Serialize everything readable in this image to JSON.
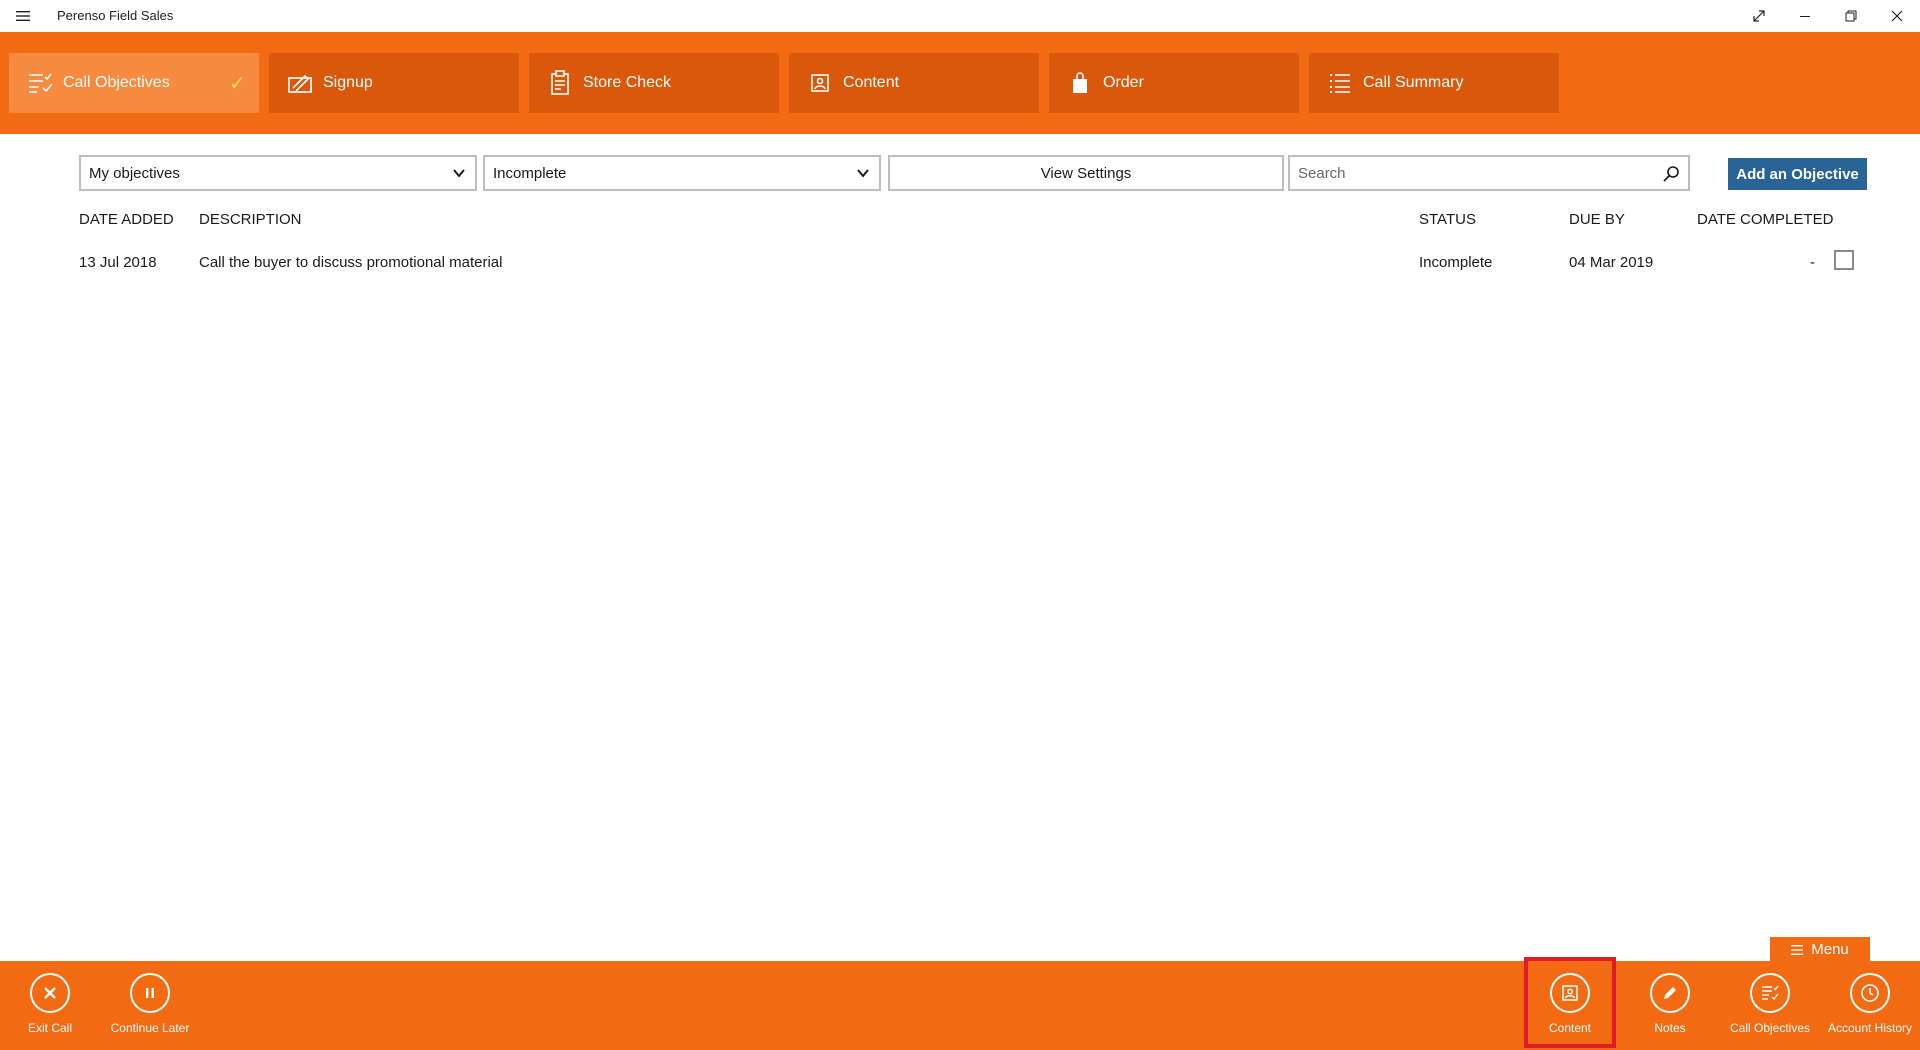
{
  "window": {
    "title": "Perenso Field Sales"
  },
  "tabs": [
    {
      "label": "Call Objectives",
      "icon": "checklist-icon",
      "active": true,
      "completed": true
    },
    {
      "label": "Signup",
      "icon": "signature-icon",
      "active": false
    },
    {
      "label": "Store Check",
      "icon": "clipboard-icon",
      "active": false
    },
    {
      "label": "Content",
      "icon": "image-icon",
      "active": false
    },
    {
      "label": "Order",
      "icon": "shopping-bag-icon",
      "active": false
    },
    {
      "label": "Call Summary",
      "icon": "list-icon",
      "active": false
    }
  ],
  "filters": {
    "owner_select": "My objectives",
    "status_select": "Incomplete",
    "view_settings_label": "View Settings",
    "search_placeholder": "Search",
    "add_button_label": "Add an Objective"
  },
  "table": {
    "columns": [
      "DATE ADDED",
      "DESCRIPTION",
      "STATUS",
      "DUE BY",
      "DATE COMPLETED"
    ],
    "rows": [
      {
        "date_added": "13 Jul 2018",
        "description": "Call the buyer to discuss promotional material",
        "status": "Incomplete",
        "due_by": "04 Mar 2019",
        "date_completed": "-",
        "checked": false
      }
    ]
  },
  "menu_label": "Menu",
  "bottom_bar": {
    "left": [
      {
        "label": "Exit Call",
        "icon": "close-icon"
      },
      {
        "label": "Continue Later",
        "icon": "pause-icon"
      }
    ],
    "right": [
      {
        "label": "Content",
        "icon": "image-icon",
        "highlighted": true
      },
      {
        "label": "Notes",
        "icon": "pencil-icon"
      },
      {
        "label": "Call Objectives",
        "icon": "checklist-icon"
      },
      {
        "label": "Account History",
        "icon": "clock-icon"
      }
    ]
  },
  "colors": {
    "brand_orange": "#f26a11",
    "tab_dark": "#d9580c",
    "tab_active": "#f68a3e",
    "check_yellow": "#ffe14a",
    "add_button_blue": "#2a6496",
    "highlight_red": "#e01b2a"
  }
}
